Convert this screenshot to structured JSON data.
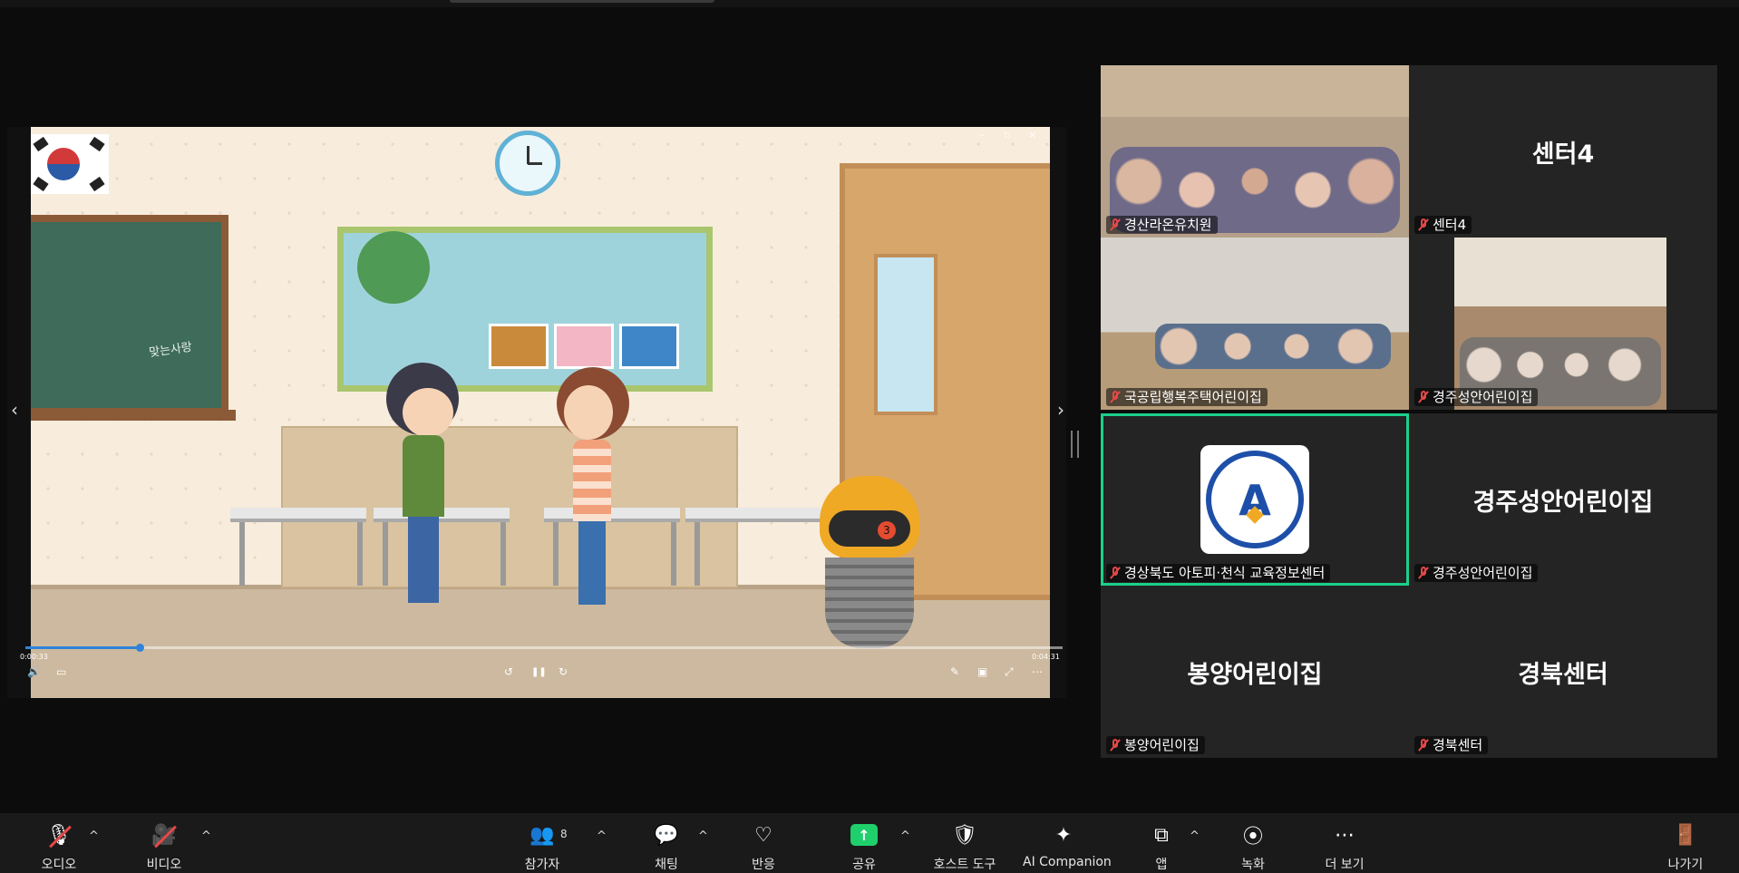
{
  "video": {
    "window_controls": [
      "–",
      "▫",
      "×"
    ],
    "chalk_text": "맞는사랑",
    "elapsed": "0:00:33",
    "duration": "0:04:31",
    "progress_fraction": 0.11,
    "controls": {
      "volume": "🔊",
      "captions": "▭",
      "rewind": "↺",
      "pause": "❚❚",
      "forward": "↻",
      "pen": "✎",
      "pip": "▣",
      "fullscreen": "⤢",
      "more": "⋯"
    },
    "prev": "‹",
    "next": "›",
    "robot_label": "3"
  },
  "gallery": {
    "tiles": [
      {
        "name": "경산라온유치원",
        "display": ""
      },
      {
        "name": "센터4",
        "display": "센터4"
      },
      {
        "name": "국공립행복주택어린이집",
        "display": ""
      },
      {
        "name": "경주성안어린이집",
        "display": ""
      },
      {
        "name": "경상북도 아토피·천식 교육정보센터",
        "display": ""
      },
      {
        "name": "경주성안어린이집",
        "display": "경주성안어린이집"
      },
      {
        "name": "봉양어린이집",
        "display": "봉양어린이집"
      },
      {
        "name": "경북센터",
        "display": "경북센터"
      }
    ]
  },
  "toolbar": {
    "audio": "오디오",
    "video": "비디오",
    "participants": "참가자",
    "participants_count": "8",
    "chat": "채팅",
    "reactions": "반응",
    "share": "공유",
    "host_tools": "호스트 도구",
    "ai": "AI Companion",
    "apps": "앱",
    "record": "녹화",
    "more": "더 보기",
    "leave": "나가기"
  },
  "colors": {
    "active_speaker": "#1bcf8a",
    "share_green": "#1fcf6b",
    "mute_red": "#e54848",
    "progress_blue": "#2f83d8"
  }
}
